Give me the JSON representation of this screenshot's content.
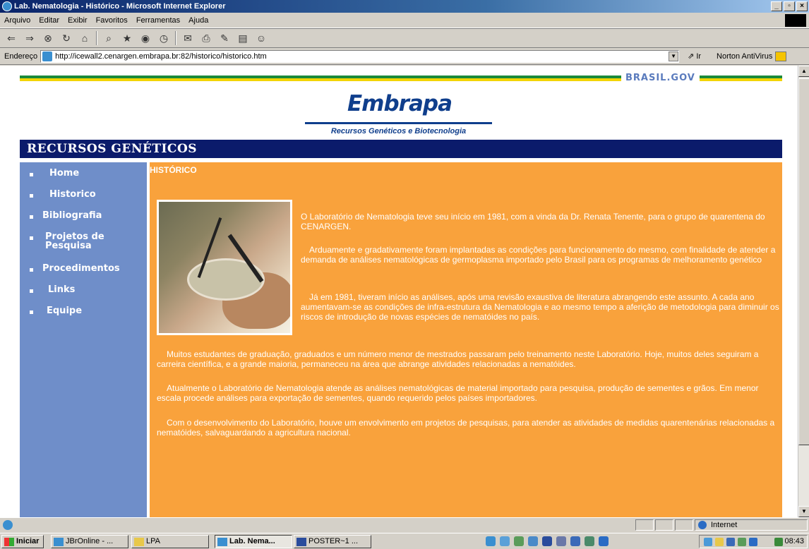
{
  "window": {
    "title": "Lab. Nematologia - Histórico - Microsoft Internet Explorer",
    "minimize": "_",
    "maximize": "▫",
    "close": "×"
  },
  "menu": [
    "Arquivo",
    "Editar",
    "Exibir",
    "Favoritos",
    "Ferramentas",
    "Ajuda"
  ],
  "address": {
    "label": "Endereço",
    "url": "http://icewall2.cenargen.embrapa.br:82/historico/historico.htm",
    "go": "Ir",
    "norton": "Norton AntiVirus"
  },
  "page": {
    "gov_label": "BRASIL.GOV",
    "logo_text": "Embrapa",
    "logo_tagline": "Recursos Genéticos e Biotecnologia",
    "section_title": "RECURSOS GENÉTICOS",
    "nav": [
      {
        "label": "Home"
      },
      {
        "label": "Historico"
      },
      {
        "label": "Bibliografia"
      },
      {
        "label": "Projetos de Pesquisa"
      },
      {
        "label": "Procedimentos"
      },
      {
        "label": "Links"
      },
      {
        "label": "Equipe"
      }
    ],
    "heading": "HISTÓRICO",
    "paragraphs": [
      "O Laboratório de Nematologia teve seu início em 1981, com a vinda da Dr. Renata Tenente, para o grupo de quarentena do CENARGEN.",
      "Arduamente e gradativamente foram implantadas as condições para funcionamento do mesmo, com finalidade de atender a demanda de análises nematológicas de germoplasma importado pelo Brasil para os programas de melhoramento genético",
      "Já em 1981, tiveram início as análises, após uma revisão exaustiva de literatura abrangendo este assunto. A cada ano aumentavam-se as condições de infra-estrutura da Nematologia e ao mesmo tempo a aferição de metodologia para diminuir os riscos de introdução de novas espécies de nematóides no país.",
      "Muitos estudantes de graduação, graduados e um número menor de mestrados passaram pelo treinamento neste Laboratório. Hoje, muitos deles seguiram a carreira científica, e a grande maioria, permaneceu na área que abrange atividades relacionadas a nematóides.",
      "Atualmente o Laboratório de Nematologia atende as análises nematológicas de material importado para pesquisa, produção de sementes e grãos. Em menor escala procede análises para exportação de sementes, quando requerido pelos países importadores.",
      "Com o desenvolvimento do Laboratório, houve um envolvimento em projetos de pesquisas, para atender as atividades de medidas quarentenárias relacionadas a nematóides, salvaguardando a agricultura nacional."
    ]
  },
  "statusbar": {
    "zone": "Internet"
  },
  "taskbar": {
    "start": "Iniciar",
    "tasks": [
      "JBrOnline - ...",
      "LPA",
      "Lab. Nema...",
      "POSTER~1 ..."
    ],
    "clock": "08:43"
  }
}
